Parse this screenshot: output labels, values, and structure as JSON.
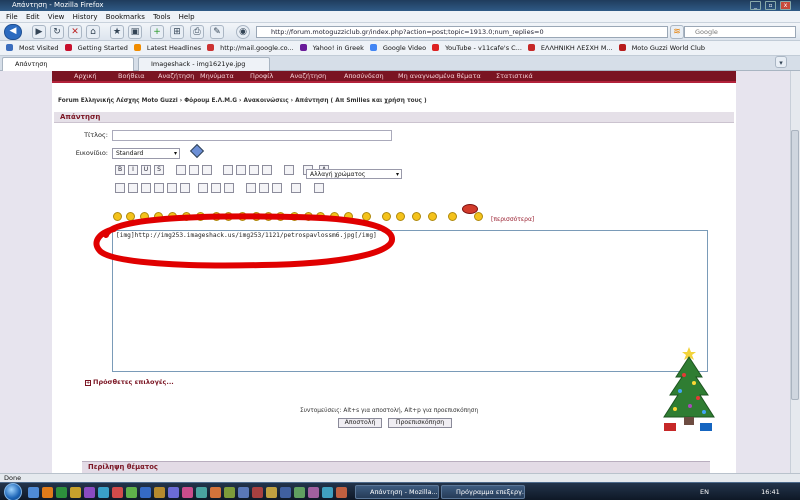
{
  "window": {
    "title": "Απάντηση - Mozilla Firefox"
  },
  "menu": [
    "File",
    "Edit",
    "View",
    "History",
    "Bookmarks",
    "Tools",
    "Help"
  ],
  "nav": {
    "url": "http://forum.motoguzziclub.gr/index.php?action=post;topic=1913.0;num_replies=0",
    "search_placeholder": "Google"
  },
  "bookmarks": [
    {
      "label": "Most Visited",
      "color": "#3b6dbd"
    },
    {
      "label": "Getting Started",
      "color": "#c8102e"
    },
    {
      "label": "Latest Headlines",
      "color": "#f08c00"
    },
    {
      "label": "http://mail.google.co...",
      "color": "#c33"
    },
    {
      "label": "Yahoo! in Greek",
      "color": "#6a1b9a"
    },
    {
      "label": "Google Video",
      "color": "#4285f4"
    },
    {
      "label": "YouTube - v11cafe's C...",
      "color": "#d22"
    },
    {
      "label": "ΕΛΛΗΝΙΚΗ ΛΕΣΧΗ M...",
      "color": "#c62828"
    },
    {
      "label": "Moto Guzzi World Club",
      "color": "#b71c1c"
    }
  ],
  "tabs": [
    {
      "label": "Απάντηση"
    },
    {
      "label": "Imageshack - img1621ye.jpg"
    }
  ],
  "forum": {
    "nav": [
      "Αρχική",
      "Βοήθεια",
      "Αναζήτηση",
      "Μηνύματα",
      "Προφίλ",
      "Αναζήτηση",
      "Αποσύνδεση",
      "Μη αναγνωσμένα θέματα",
      "Στατιστικά"
    ],
    "breadcrumb": "Forum Ελληνικής Λέσχης Moto Guzzi › Φόρουμ E.Λ.M.G › Ανακοινώσεις › Απάντηση ( Απ Smilies και χρήση τους )",
    "panel_title": "Απάντηση",
    "title_label": "Τίτλος:",
    "icon_label": "Εικονίδιο:",
    "icon_value": "Standard",
    "color_select": "Αλλαγή χρώματος",
    "more_smileys": "[περισσότερα]",
    "message": "[img]http://img253.imageshack.us/img253/1121/petrospavlossm6.jpg[/img]",
    "additional_options": "Πρόσθετες επιλογές...",
    "shortcuts": "Συντομεύσεις: Alt+s για αποστολή, Alt+p για προεπισκόπηση",
    "submit": "Αποστολή",
    "preview": "Προεπισκόπηση",
    "summary": "Περίληψη θέματος"
  },
  "toolbar_row1": [
    "B",
    "I",
    "U",
    "S",
    "",
    "",
    "",
    "",
    "",
    "",
    "",
    "",
    "",
    "A"
  ],
  "toolbar_row2": [
    "",
    "",
    "",
    "",
    "",
    "",
    "",
    "",
    "",
    "",
    "",
    "",
    "",
    ""
  ],
  "status": "Done",
  "taskbar": {
    "windows": [
      {
        "label": "Απάντηση - Mozilla..."
      },
      {
        "label": "Πρόγραμμα επεξεργ..."
      }
    ],
    "lang": "EN",
    "time": "16:41"
  }
}
